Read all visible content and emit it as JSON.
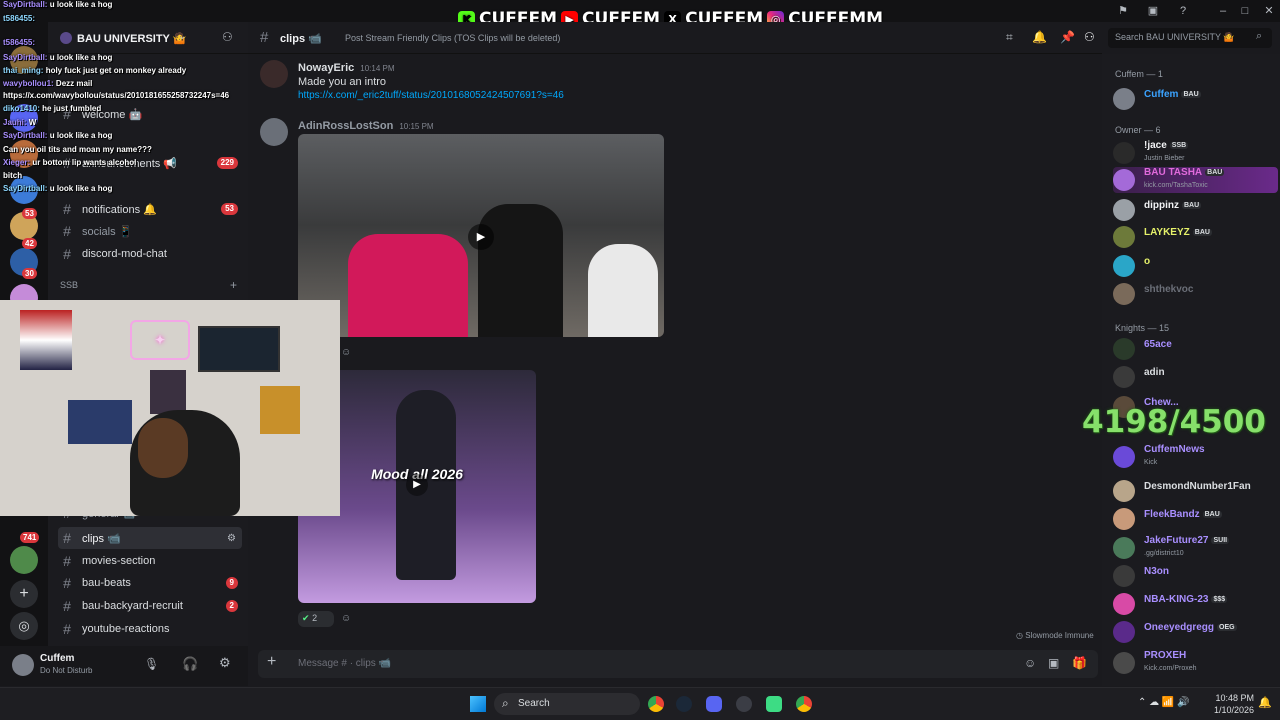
{
  "banner": {
    "handles": [
      "CUFFEM",
      "CUFFEM",
      "CUFFEM",
      "CUFFEMM"
    ],
    "icons": [
      "kick-icon",
      "youtube-icon",
      "x-icon",
      "instagram-icon"
    ],
    "window_title": "BAU UNIVERSITY"
  },
  "server": {
    "name": "BAU UNIVERSITY 🤷"
  },
  "server_badges": [
    "229",
    "53",
    "42",
    "30",
    "741"
  ],
  "channels": [
    {
      "label": "welcome 🤖",
      "badge": ""
    },
    {
      "label": "announcements 📢",
      "badge": "229"
    },
    {
      "label": "notifications 🔔",
      "badge": "53"
    },
    {
      "label": "socials 📱",
      "badge": ""
    },
    {
      "label": "discord-mod-chat",
      "badge": ""
    },
    {
      "label": "SSB",
      "badge": ""
    },
    {
      "label": "general 📹",
      "badge": ""
    },
    {
      "label": "clips 📹",
      "badge": ""
    },
    {
      "label": "movies-section",
      "badge": ""
    },
    {
      "label": "bau-beats",
      "badge": "9"
    },
    {
      "label": "bau-backyard-recruit",
      "badge": "2"
    },
    {
      "label": "youtube-reactions",
      "badge": ""
    }
  ],
  "user": {
    "name": "Cuffem",
    "status": "Do Not Disturb"
  },
  "chat_header": {
    "channel": "clips 📹",
    "topic": "Post Stream Friendly Clips (TOS Clips will be deleted)",
    "search_placeholder": "Search BAU UNIVERSITY 🤷"
  },
  "messages": [
    {
      "author": "NowayEric",
      "time": "10:14 PM",
      "text": "Made you an intro",
      "link": "https://x.com/_eric2tuff/status/2010168052424507691?s=46"
    },
    {
      "author": "AdinRossLostSon",
      "time": "10:15 PM",
      "video2_caption": "Mood all 2026",
      "reactions": "2"
    }
  ],
  "slowmode": "Slowmode Immune",
  "composer": {
    "placeholder": "Message # · clips 📹"
  },
  "members": {
    "groups": [
      {
        "label": "Cuffem — 1"
      },
      {
        "label": "Owner — 6"
      },
      {
        "label": "Knights — 15"
      }
    ],
    "list": [
      {
        "name": "Cuffem",
        "tag": "BAU",
        "sub": "",
        "color": "#3ba3ff"
      },
      {
        "name": "!jace",
        "tag": "SSB",
        "sub": "Justin Bieber",
        "color": "#f2f3f5"
      },
      {
        "name": "BAU TASHA",
        "tag": "BAU",
        "sub": "kick.com/TashaToxic",
        "color": "#e06adb"
      },
      {
        "name": "dippinz",
        "tag": "BAU",
        "sub": "",
        "color": "#f2f3f5"
      },
      {
        "name": "LAYKEYZ",
        "tag": "BAU",
        "sub": "",
        "color": "#e6f26a"
      },
      {
        "name": "o",
        "tag": "",
        "sub": "",
        "color": "#e6f26a"
      },
      {
        "name": "shthekvoc",
        "tag": "",
        "sub": "",
        "color": "#6b6f78"
      },
      {
        "name": "65ace",
        "tag": "",
        "sub": "",
        "color": "#a98fff"
      },
      {
        "name": "adin",
        "tag": "",
        "sub": "",
        "color": "#dbdee1"
      },
      {
        "name": "Chew...",
        "tag": "",
        "sub": "",
        "color": "#a98fff"
      },
      {
        "name": "CuffemNews",
        "tag": "",
        "sub": "Kick",
        "color": "#a98fff"
      },
      {
        "name": "DesmondNumber1Fan",
        "tag": "",
        "sub": "",
        "color": "#dbdee1"
      },
      {
        "name": "FleekBandz",
        "tag": "BAU",
        "sub": "",
        "color": "#a98fff"
      },
      {
        "name": "JakeFuture27",
        "tag": "SUII",
        "sub": ".gg/district10",
        "color": "#a98fff"
      },
      {
        "name": "N3on",
        "tag": "",
        "sub": "",
        "color": "#a98fff"
      },
      {
        "name": "NBA-KING-23",
        "tag": "$$$",
        "sub": "",
        "color": "#a98fff"
      },
      {
        "name": "Oneeyedgregg",
        "tag": "OEG",
        "sub": "",
        "color": "#a98fff"
      },
      {
        "name": "PROXEH",
        "tag": "",
        "sub": "Kick.com/Proxeh",
        "color": "#a98fff"
      }
    ]
  },
  "counter": "4198/4500",
  "chat_overlay": [
    {
      "name": "SayDirtball:",
      "msg": "u look like a hog"
    },
    {
      "name": "t586455:",
      "msg": ""
    },
    {
      "name": "t586455:",
      "msg": ""
    },
    {
      "name": "SayDirtball:",
      "msg": "u look like a hog"
    },
    {
      "name": "thai_ming:",
      "msg": "holy fuck just get on monkey already"
    },
    {
      "name": "wavybollou1:",
      "msg": "Dezz mail"
    },
    {
      "name": "",
      "msg": "https://x.com/wavybollou/status/2010181655258732247s=46"
    },
    {
      "name": "diko1410:",
      "msg": "he just fumbled"
    },
    {
      "name": "Jauhi:",
      "msg": "W"
    },
    {
      "name": "SayDirtball:",
      "msg": "u look like a hog"
    },
    {
      "name": "",
      "msg": "Can you oil tits and moan my name???"
    },
    {
      "name": "Xieger:",
      "msg": "ur bottom lip wants alcohol"
    },
    {
      "name": "",
      "msg": "bitch"
    },
    {
      "name": "SayDirtball:",
      "msg": "u look like a hog"
    }
  ],
  "taskbar": {
    "search": "Search",
    "time": "10:48 PM",
    "date": "1/10/2026"
  }
}
